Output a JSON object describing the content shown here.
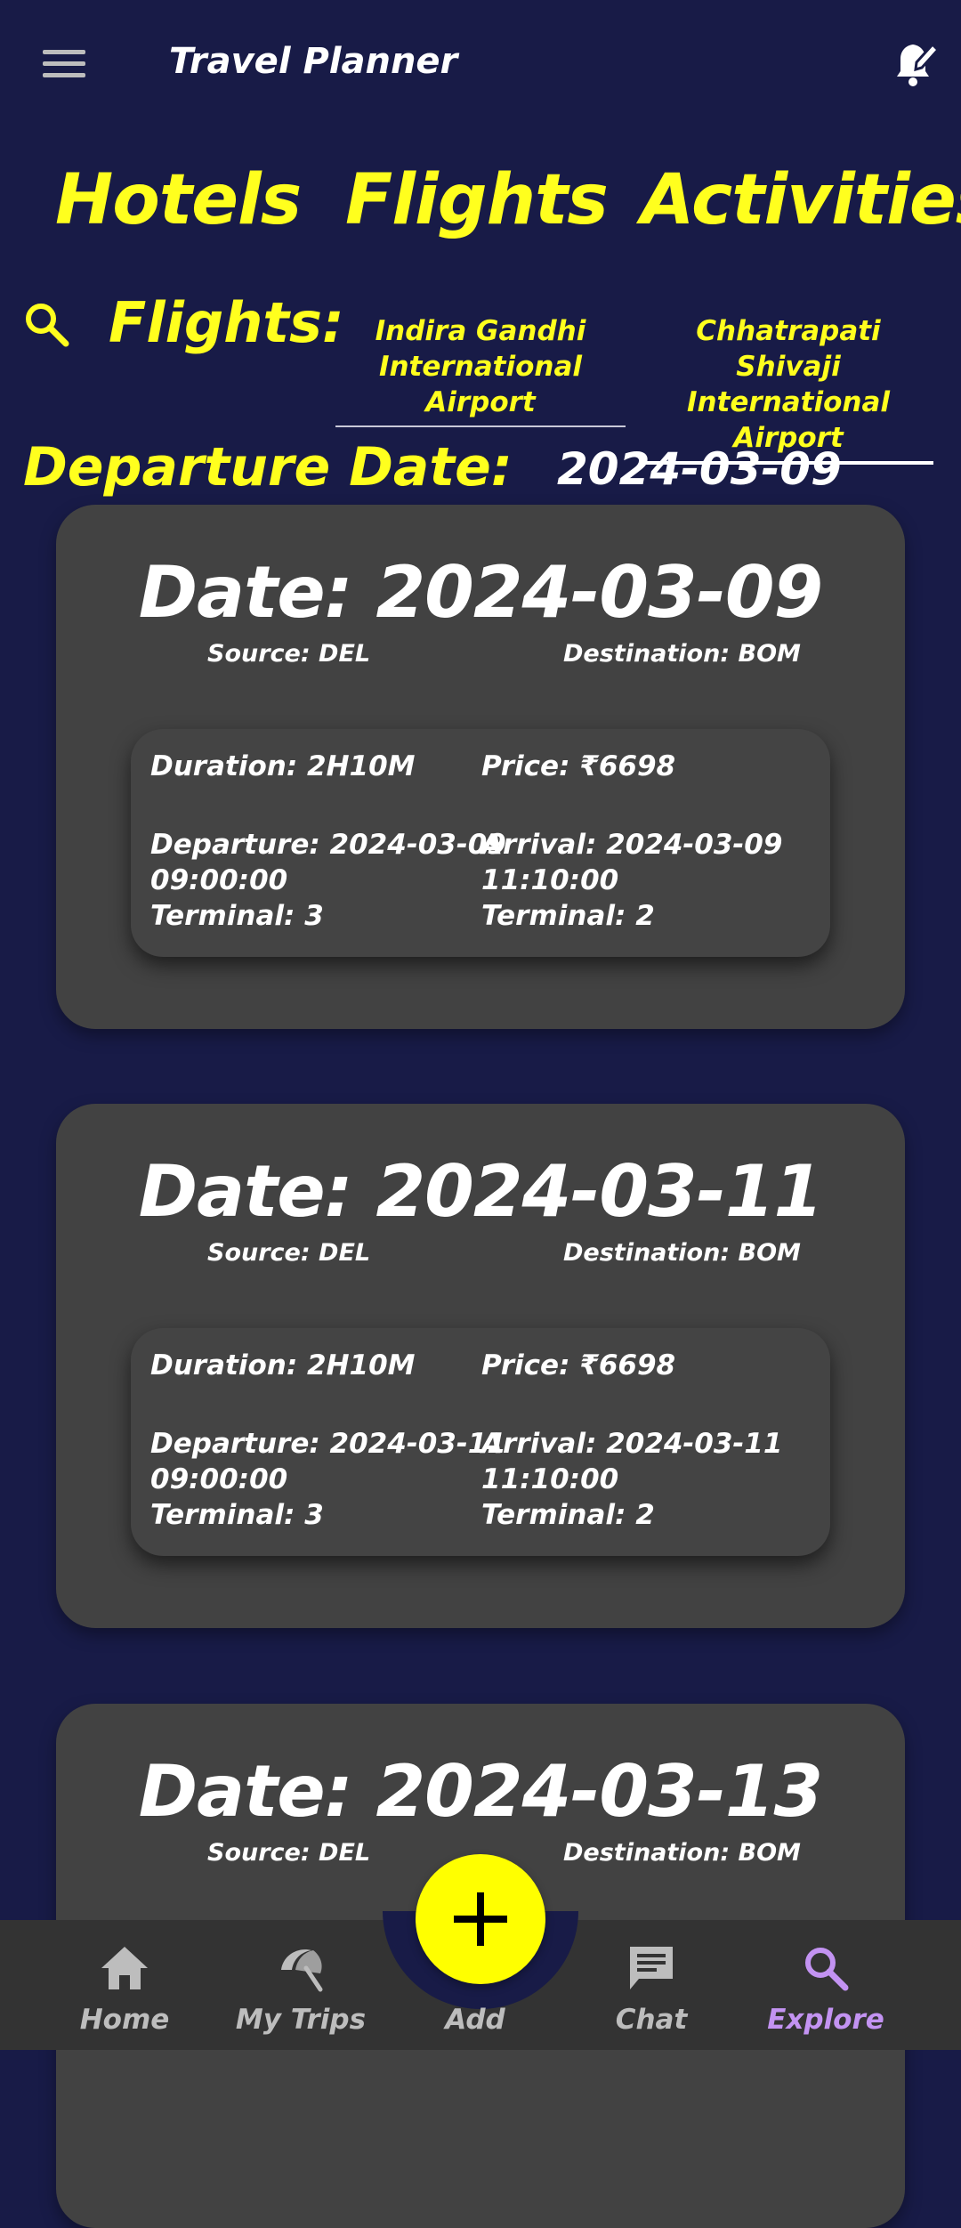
{
  "header": {
    "title": "Travel Planner",
    "menu_icon": "hamburger-menu-icon",
    "bell_icon": "notification-bell-edit-icon"
  },
  "tabs": [
    {
      "label": "Hotels"
    },
    {
      "label": "Flights"
    },
    {
      "label": "Activities"
    }
  ],
  "search": {
    "icon": "search-icon",
    "label": "Flights:",
    "source_airport": "Indira Gandhi International Airport",
    "destination_airport": "Chhatrapati Shivaji International Airport"
  },
  "departure": {
    "label": "Departure Date:",
    "value": "2024-03-09"
  },
  "flights": [
    {
      "date": "Date: 2024-03-09",
      "source": "Source: DEL",
      "destination": "Destination: BOM",
      "duration": "Duration: 2H10M",
      "price": "Price: ₹6698",
      "departure_line1": "Departure: 2024-03-09",
      "departure_line2": "09:00:00",
      "departure_terminal": "Terminal: 3",
      "arrival_line1": "Arrival: 2024-03-09",
      "arrival_line2": "11:10:00",
      "arrival_terminal": "Terminal: 2"
    },
    {
      "date": "Date: 2024-03-11",
      "source": "Source: DEL",
      "destination": "Destination: BOM",
      "duration": "Duration: 2H10M",
      "price": "Price: ₹6698",
      "departure_line1": "Departure: 2024-03-11",
      "departure_line2": "09:00:00",
      "departure_terminal": "Terminal: 3",
      "arrival_line1": "Arrival: 2024-03-11",
      "arrival_line2": "11:10:00",
      "arrival_terminal": "Terminal: 2"
    },
    {
      "date": "Date: 2024-03-13",
      "source": "Source: DEL",
      "destination": "Destination: BOM"
    }
  ],
  "bottom_nav": [
    {
      "label": "Home",
      "icon": "home-icon"
    },
    {
      "label": "My Trips",
      "icon": "beach-umbrella-icon"
    },
    {
      "label": "Add",
      "icon": "plus-icon"
    },
    {
      "label": "Chat",
      "icon": "chat-icon"
    },
    {
      "label": "Explore",
      "icon": "search-icon",
      "active": true
    }
  ],
  "colors": {
    "background": "#181b47",
    "accent_yellow": "#ffff1e",
    "card": "#424242",
    "nav_active": "#c393f2"
  }
}
